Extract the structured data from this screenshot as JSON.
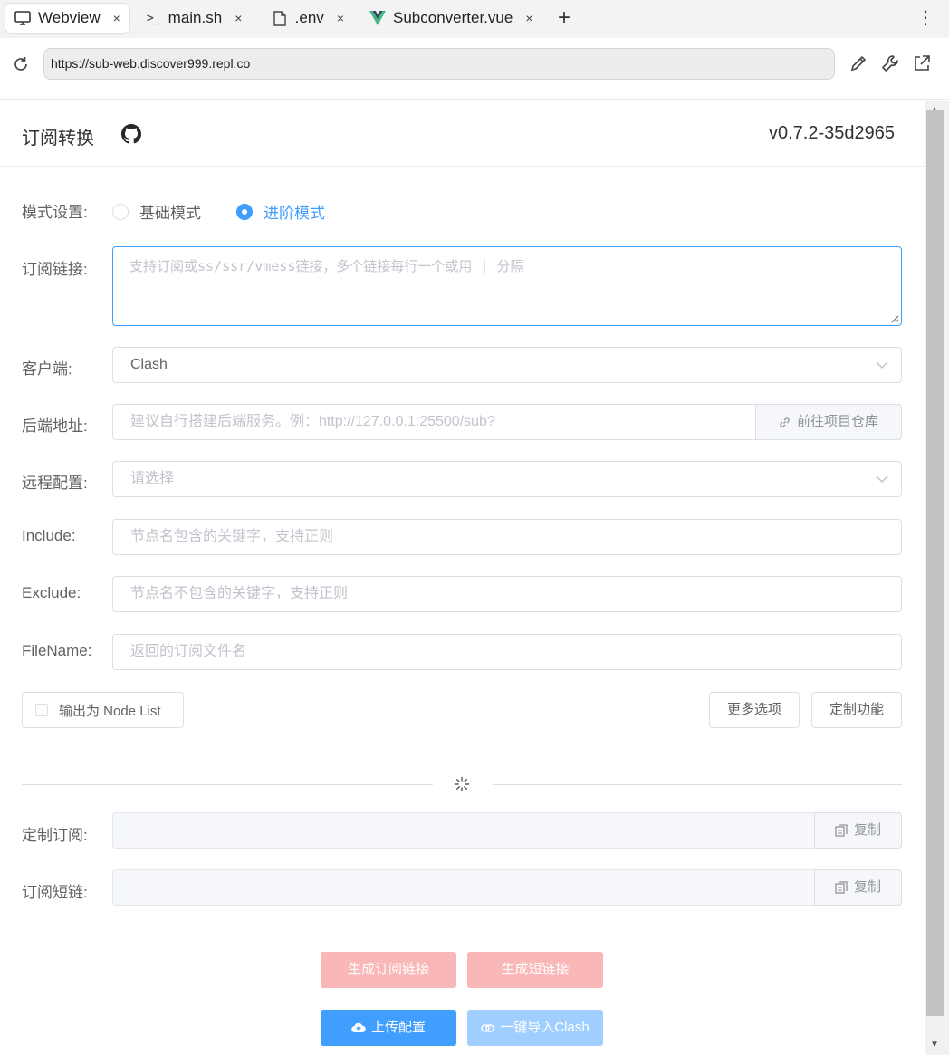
{
  "browser": {
    "tabs": [
      {
        "label": "Webview",
        "icon": "monitor-icon",
        "close": "×"
      },
      {
        "label": "main.sh",
        "icon": "terminal-icon",
        "close": "×"
      },
      {
        "label": ".env",
        "icon": "file-icon",
        "close": "×"
      },
      {
        "label": "Subconverter.vue",
        "icon": "vue-icon",
        "close": "×"
      }
    ],
    "url": "https://sub-web.discover999.repl.co"
  },
  "header": {
    "title": "订阅转换",
    "version": "v0.7.2-35d2965"
  },
  "form": {
    "mode_label": "模式设置:",
    "mode_basic": "基础模式",
    "mode_advanced": "进阶模式",
    "mode_selected": "进阶模式",
    "sub_label": "订阅链接:",
    "sub_placeholder": "支持订阅或ss/ssr/vmess链接，多个链接每行一个或用 | 分隔",
    "client_label": "客户端:",
    "client_value": "Clash",
    "backend_label": "后端地址:",
    "backend_placeholder": "建议自行搭建后端服务。例：http://127.0.0.1:25500/sub?",
    "backend_repo_button": "前往项目仓库",
    "remote_label": "远程配置:",
    "remote_placeholder": "请选择",
    "include_label": "Include:",
    "include_placeholder": "节点名包含的关键字，支持正则",
    "exclude_label": "Exclude:",
    "exclude_placeholder": "节点名不包含的关键字，支持正则",
    "filename_label": "FileName:",
    "filename_placeholder": "返回的订阅文件名",
    "nodelist_checkbox": "输出为 Node List",
    "more_options_button": "更多选项",
    "custom_features_button": "定制功能"
  },
  "result": {
    "custom_sub_label": "定制订阅:",
    "short_link_label": "订阅短链:",
    "copy_button": "复制"
  },
  "actions": {
    "generate_sub": "生成订阅链接",
    "generate_short": "生成短链接",
    "upload_config": "上传配置",
    "import_clash": "一键导入Clash"
  },
  "colors": {
    "primary": "#409eff",
    "danger_disabled": "#f9b7b8",
    "primary_disabled": "#a0cfff"
  }
}
